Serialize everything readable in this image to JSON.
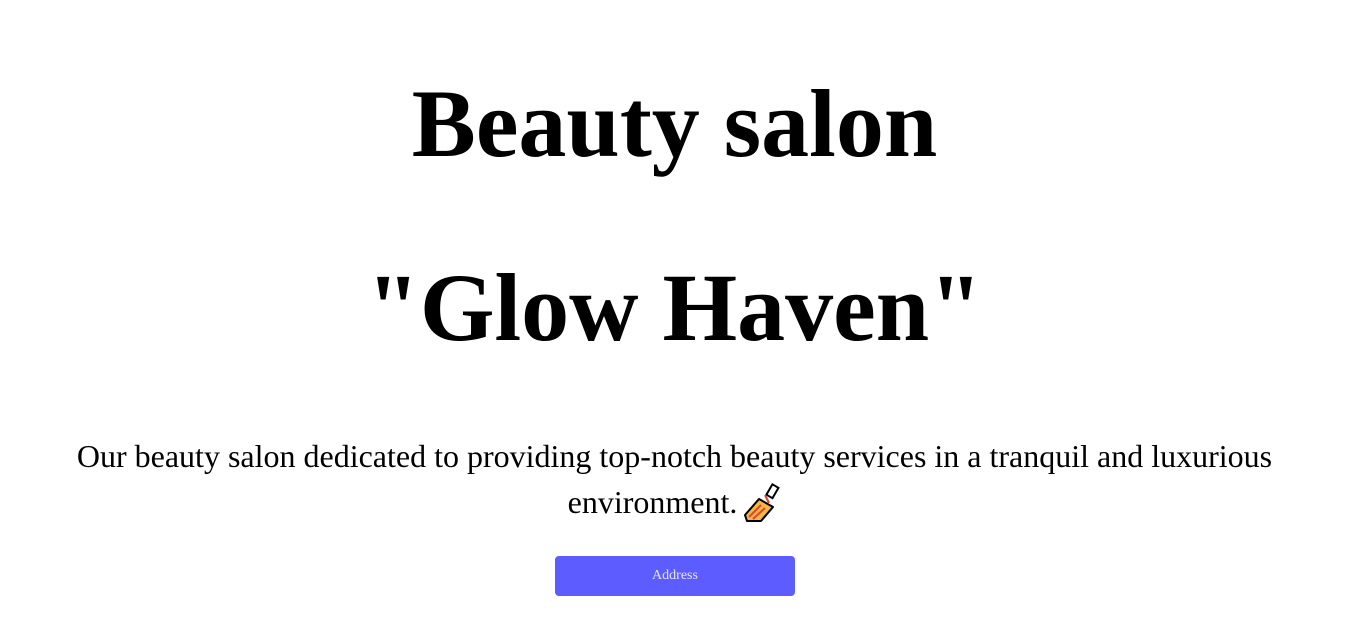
{
  "header": {
    "title_line1": "Beauty salon",
    "title_line2": "\"Glow Haven\""
  },
  "main": {
    "description": "Our beauty salon dedicated to providing top-notch beauty services in a tranquil and luxurious environment.",
    "description_icon": "nail-polish-icon",
    "address_button_label": "Address"
  },
  "colors": {
    "button_background": "#5c5cff",
    "button_text": "#e6e6ff",
    "text": "#000000",
    "background": "#ffffff"
  }
}
